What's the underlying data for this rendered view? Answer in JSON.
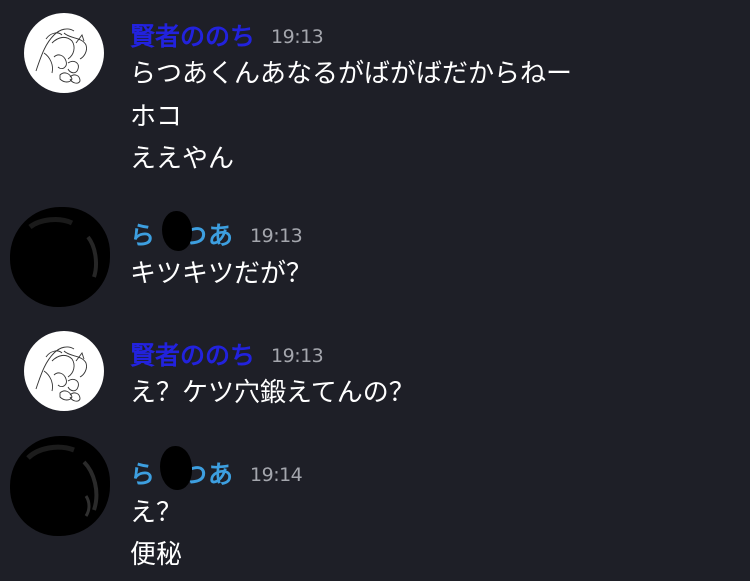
{
  "messages": [
    {
      "username": "賢者ののち",
      "time": "19:13",
      "lines": [
        "らつあくんあなるがばがばだからねー",
        "ホコ",
        "ええやん"
      ]
    },
    {
      "username": "ら　つあ",
      "time": "19:13",
      "lines": [
        "キツキツだが？"
      ]
    },
    {
      "username": "賢者ののち",
      "time": "19:13",
      "lines": [
        "え？ケツ穴鍛えてんの？"
      ]
    },
    {
      "username": "ら　つあ",
      "time": "19:14",
      "lines": [
        "え？",
        "便秘"
      ]
    }
  ],
  "colors": {
    "background": "#1e1f27",
    "username_kenja": "#2222dd",
    "username_ratsua": "#3d9fe0",
    "timestamp": "#a4a6ad",
    "text": "#ffffff"
  }
}
